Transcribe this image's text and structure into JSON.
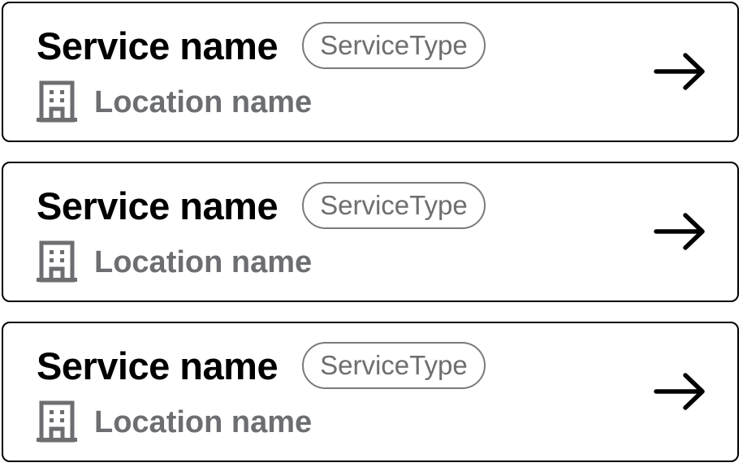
{
  "cards": [
    {
      "service_name": "Service name",
      "service_type": "ServiceType",
      "location_name": "Location name",
      "location_icon": "building-icon",
      "action_icon": "arrow-right-icon"
    },
    {
      "service_name": "Service name",
      "service_type": "ServiceType",
      "location_name": "Location name",
      "location_icon": "building-icon",
      "action_icon": "arrow-right-icon"
    },
    {
      "service_name": "Service name",
      "service_type": "ServiceType",
      "location_name": "Location name",
      "location_icon": "building-icon",
      "action_icon": "arrow-right-icon"
    }
  ],
  "colors": {
    "border": "#000000",
    "title": "#000000",
    "tag_border": "#7a7a7a",
    "tag_text": "#6e6e6e",
    "location_text": "#6c6e71"
  }
}
